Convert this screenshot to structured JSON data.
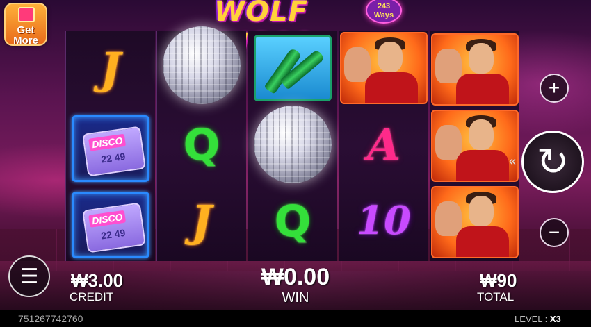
{
  "logo": {
    "title": "WOLF DISCO",
    "ways": "243 Ways"
  },
  "get_more": {
    "line1": "Get",
    "line2": "More"
  },
  "reels": [
    [
      "J",
      "disco-pager",
      "disco-pager"
    ],
    [
      "disco-ball",
      "Q",
      "J"
    ],
    [
      "bottles",
      "disco-ball",
      "Q"
    ],
    [
      "wolf-man",
      "A",
      "10"
    ],
    [
      "wolf-man",
      "wolf-man",
      "wolf-man"
    ]
  ],
  "pager_text": {
    "label": "DISCO",
    "digits": "22 49"
  },
  "controls": {
    "plus": "+",
    "minus": "−",
    "spin": "↻",
    "menu": "☰",
    "spin_hint": "«"
  },
  "bottom": {
    "credit_value": "₩3.00",
    "credit_label": "CREDIT",
    "win_value": "₩0.00",
    "win_label": "WIN",
    "total_value": "₩90",
    "total_label": "TOTAL"
  },
  "footer": {
    "id": "751267742760",
    "level_label": "LEVEL : ",
    "level_value": "X3"
  }
}
